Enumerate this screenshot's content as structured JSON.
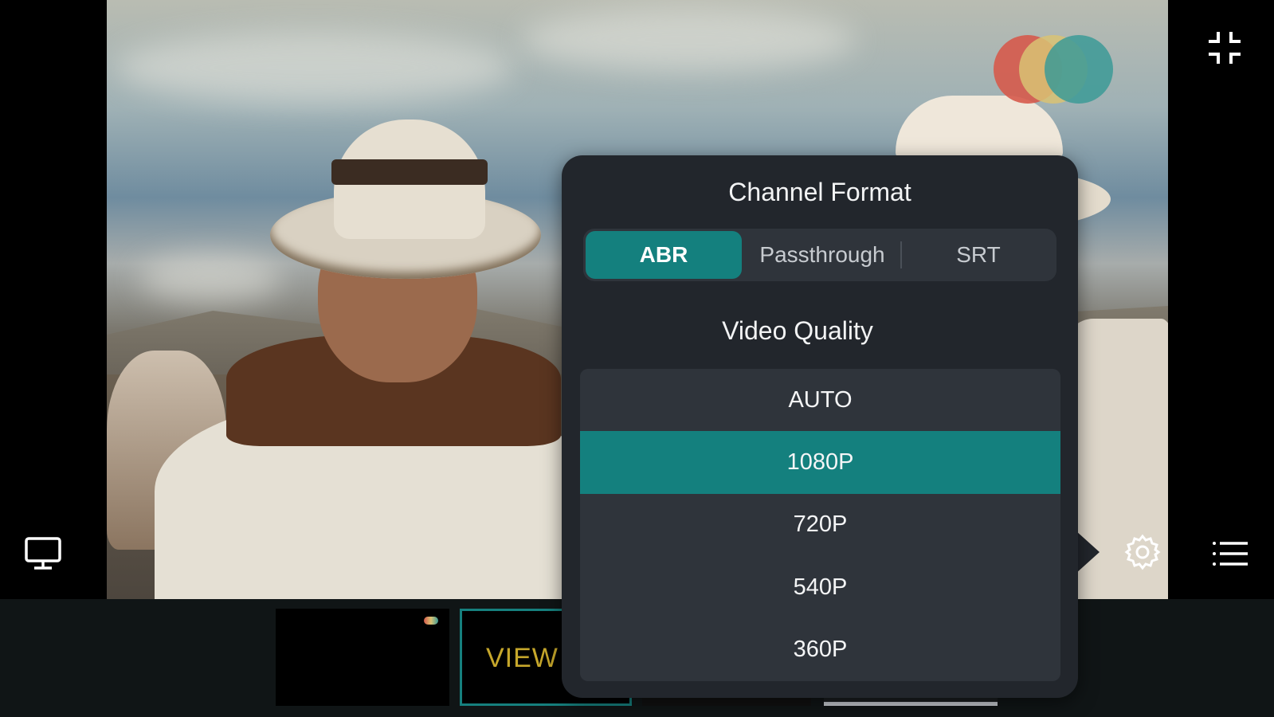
{
  "popover": {
    "channel_format_title": "Channel Format",
    "formats": [
      "ABR",
      "Passthrough",
      "SRT"
    ],
    "selected_format": "ABR",
    "video_quality_title": "Video Quality",
    "qualities": [
      "AUTO",
      "1080P",
      "720P",
      "540P",
      "360P"
    ],
    "selected_quality": "1080P"
  },
  "thumbnails": [
    {
      "label": ""
    },
    {
      "label": "VIEW"
    },
    {
      "label": ""
    },
    {
      "label": ""
    }
  ],
  "colors": {
    "accent": "#14807e",
    "popover_bg": "#22262c",
    "list_bg": "#2f343b",
    "logo": [
      "#d65a4b",
      "#d9c273",
      "#3c9a96"
    ]
  },
  "icons": {
    "top_right": "exit-fullscreen-icon",
    "bottom_left": "monitor-icon",
    "bottom_right": "list-icon",
    "settings": "gear-icon"
  }
}
